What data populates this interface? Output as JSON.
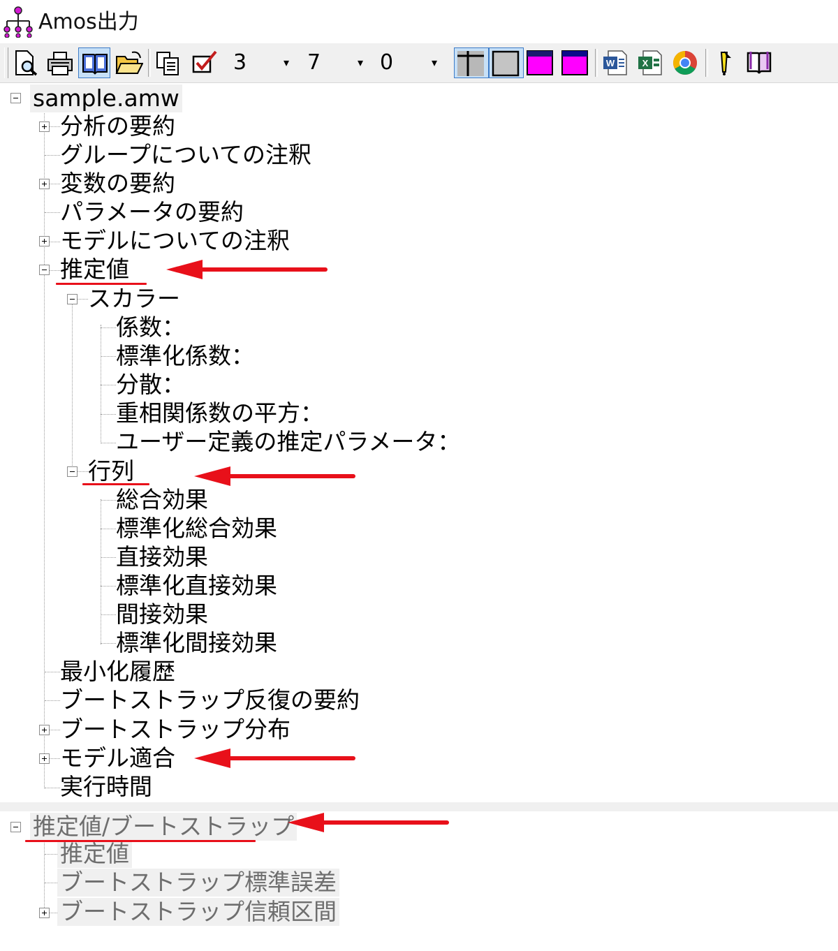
{
  "window": {
    "title": "Amos出力"
  },
  "toolbar": {
    "buttons": [
      {
        "icon": "print-preview-icon"
      },
      {
        "icon": "printer-icon"
      },
      {
        "icon": "open-book-icon",
        "pressed": true
      },
      {
        "icon": "open-folder-icon"
      },
      {
        "icon": "copy-icon"
      },
      {
        "icon": "checkbox-icon"
      }
    ],
    "spin1": "3",
    "spin2": "7",
    "spin3": "0",
    "spin_arrow": "▾",
    "view_buttons": [
      {
        "icon": "grid-lines-icon",
        "pressed": true
      },
      {
        "icon": "gray-table-icon",
        "pressed": true
      },
      {
        "icon": "magenta-table-icon"
      },
      {
        "icon": "magenta-table-icon"
      }
    ],
    "app_buttons": [
      {
        "icon": "word-icon"
      },
      {
        "icon": "excel-icon"
      },
      {
        "icon": "chrome-icon"
      },
      {
        "icon": "help-pointer-icon"
      },
      {
        "icon": "help-book-icon"
      }
    ]
  },
  "tree": {
    "root": "sample.amw",
    "items": {
      "analysis_summary": "分析の要約",
      "group_notes": "グループについての注釈",
      "variable_summary": "変数の要約",
      "parameter_summary": "パラメータの要約",
      "model_notes": "モデルについての注釈",
      "estimates": "推定値",
      "scalars": "スカラー",
      "coefficients": "係数：",
      "std_coefficients": "標準化係数：",
      "variances": "分散：",
      "smc": "重相関係数の平方：",
      "user_params": "ユーザー定義の推定パラメータ：",
      "matrices": "行列",
      "total_effects": "総合効果",
      "std_total_effects": "標準化総合効果",
      "direct_effects": "直接効果",
      "std_direct_effects": "標準化直接効果",
      "indirect_effects": "間接効果",
      "std_indirect_effects": "標準化間接効果",
      "minimization_history": "最小化履歴",
      "bootstrap_iterations": "ブートストラップ反復の要約",
      "bootstrap_distributions": "ブートストラップ分布",
      "model_fit": "モデル適合",
      "execution_time": "実行時間"
    }
  },
  "tree2": {
    "root": "推定値/ブートストラップ",
    "items": {
      "estimates": "推定値",
      "bootstrap_se": "ブートストラップ標準誤差",
      "bootstrap_ci": "ブートストラップ信頼区間"
    }
  },
  "annotations": {
    "color": "#e8101a"
  }
}
